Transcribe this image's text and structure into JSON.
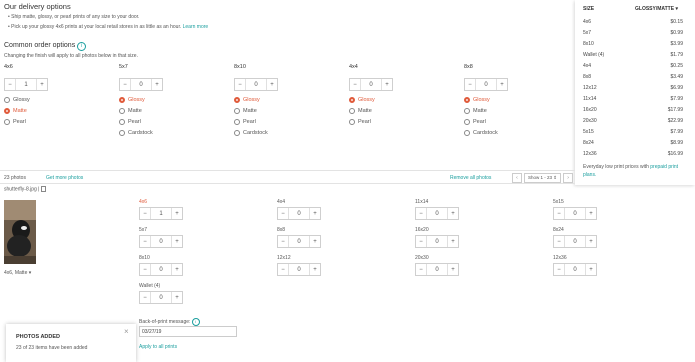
{
  "delivery": {
    "title": "Our delivery options",
    "bullets": [
      "Ship matte, glossy, or pearl prints of any size to your door.",
      "Pick up your glossy 4x6 prints at your local retail stores in as little as an hour."
    ],
    "learn_more": "Learn more"
  },
  "common": {
    "title": "Common order options",
    "info_icon": "info-icon",
    "note": "Changing the finish will apply to all photos below in that size.",
    "columns": [
      {
        "size": "4x6",
        "qty": "1",
        "options": [
          "Glossy",
          "Matte",
          "Pearl"
        ],
        "selected": "Matte"
      },
      {
        "size": "5x7",
        "qty": "0",
        "options": [
          "Glossy",
          "Matte",
          "Pearl",
          "Cardstock"
        ],
        "selected": "Glossy"
      },
      {
        "size": "8x10",
        "qty": "0",
        "options": [
          "Glossy",
          "Matte",
          "Pearl",
          "Cardstock"
        ],
        "selected": "Glossy"
      },
      {
        "size": "4x4",
        "qty": "0",
        "options": [
          "Glossy",
          "Matte",
          "Pearl"
        ],
        "selected": "Glossy"
      },
      {
        "size": "8x8",
        "qty": "0",
        "options": [
          "Glossy",
          "Matte",
          "Pearl",
          "Cardstock"
        ],
        "selected": "Glossy"
      }
    ],
    "minus": "−",
    "plus": "+"
  },
  "prices": {
    "col_size": "SIZE",
    "col_finish": "GLOSSY/MATTE",
    "rows": [
      [
        "4x6",
        "$0.15"
      ],
      [
        "5x7",
        "$0.99"
      ],
      [
        "8x10",
        "$3.99"
      ],
      [
        "Wallet (4)",
        "$1.79"
      ],
      [
        "4x4",
        "$0.25"
      ],
      [
        "8x8",
        "$3.49"
      ],
      [
        "12x12",
        "$6.99"
      ],
      [
        "11x14",
        "$7.99"
      ],
      [
        "16x20",
        "$17.99"
      ],
      [
        "20x30",
        "$22.99"
      ],
      [
        "5x15",
        "$7.99"
      ],
      [
        "8x24",
        "$8.99"
      ],
      [
        "12x36",
        "$16.99"
      ]
    ],
    "footer_text": "Everyday low print prices with ",
    "footer_link": "prepaid print plans."
  },
  "photos_bar": {
    "count": "23 photos",
    "get_more": "Get more photos",
    "remove_all": "Remove all photos",
    "show": "Show 1 - 23 ⇕"
  },
  "photo": {
    "filename": "shutterfly-8.jpg",
    "caption": "4x6, Matte",
    "sizes": [
      {
        "label": "4x6",
        "qty": "1",
        "active": true
      },
      {
        "label": "4x4",
        "qty": "0"
      },
      {
        "label": "11x14",
        "qty": "0"
      },
      {
        "label": "5x15",
        "qty": "0"
      },
      {
        "label": "5x7",
        "qty": "0"
      },
      {
        "label": "8x8",
        "qty": "0"
      },
      {
        "label": "16x20",
        "qty": "0"
      },
      {
        "label": "8x24",
        "qty": "0"
      },
      {
        "label": "8x10",
        "qty": "0"
      },
      {
        "label": "12x12",
        "qty": "0"
      },
      {
        "label": "20x30",
        "qty": "0"
      },
      {
        "label": "12x36",
        "qty": "0"
      },
      {
        "label": "Wallet (4)",
        "qty": "0"
      }
    ],
    "back_label": "Back-of-print message:",
    "back_value": "03/27/19",
    "apply_all": "Apply to all prints"
  },
  "toast": {
    "title": "PHOTOS ADDED",
    "text": "23 of 23 items have been added",
    "close": "×"
  },
  "colors": {
    "accent": "#e05a3a",
    "link": "#1a9e9e"
  }
}
